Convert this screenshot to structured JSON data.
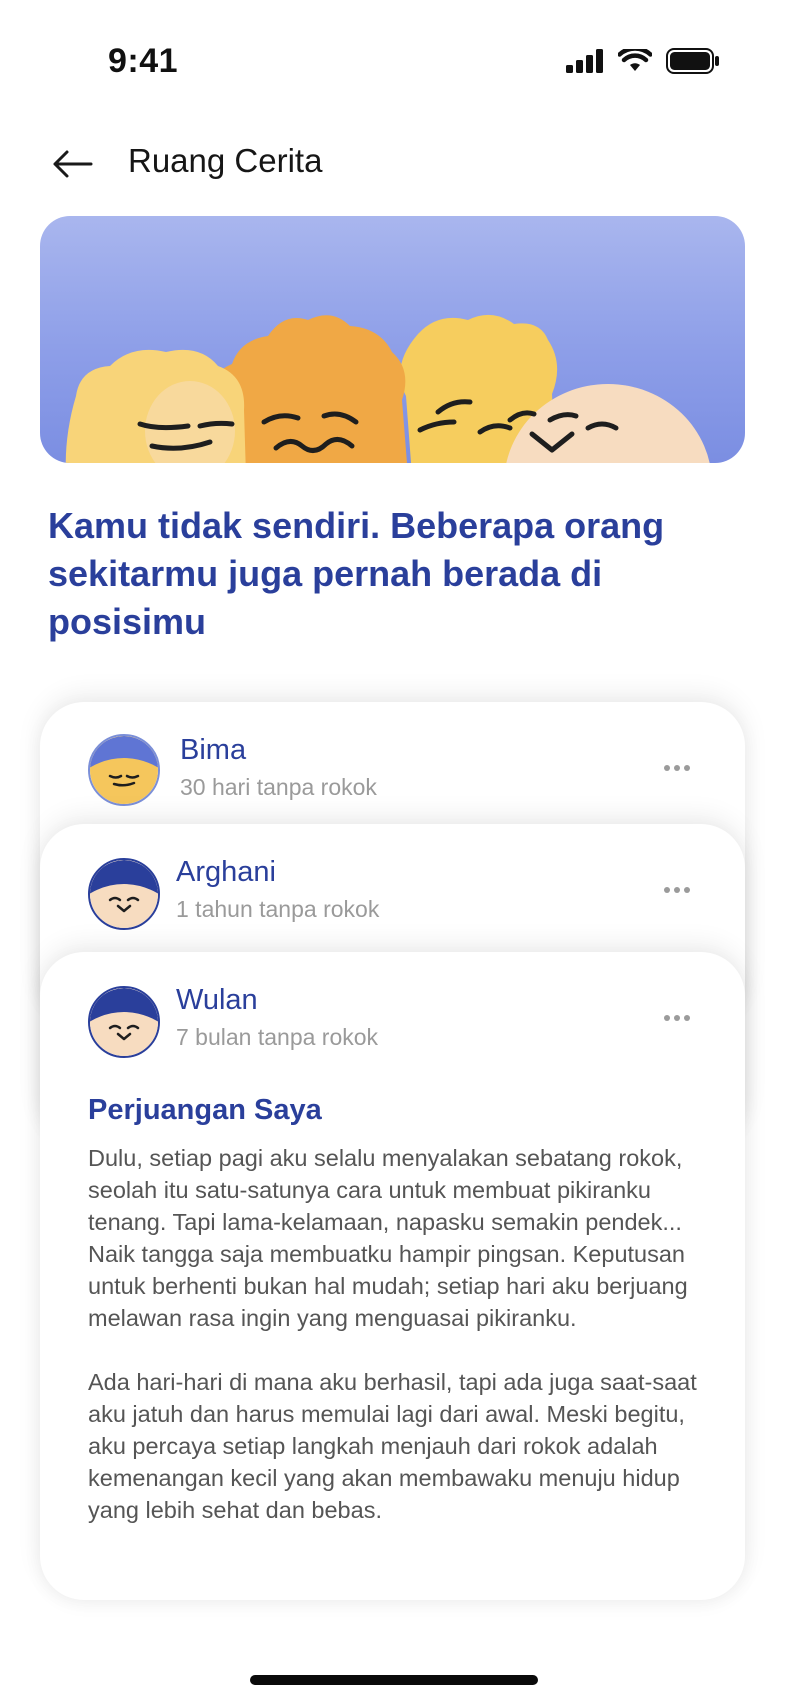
{
  "status_bar": {
    "time": "9:41"
  },
  "header": {
    "title": "Ruang Cerita"
  },
  "headline": "Kamu tidak sendiri. Beberapa orang sekitarmu juga pernah berada di posisimu",
  "stories": [
    {
      "name": "Bima",
      "subtitle": "30 hari tanpa rokok"
    },
    {
      "name": "Arghani",
      "subtitle": "1 tahun tanpa rokok"
    },
    {
      "name": "Wulan",
      "subtitle": "7 bulan tanpa rokok",
      "title": "Perjuangan Saya",
      "paragraphs": [
        "Dulu, setiap pagi aku selalu menyalakan sebatang rokok, seolah itu satu-satunya cara untuk membuat pikiranku tenang. Tapi lama-kelamaan, napasku semakin pendek... Naik tangga saja membuatku hampir pingsan. Keputusan untuk berhenti bukan hal mudah; setiap hari aku berjuang melawan rasa ingin yang menguasai pikiranku.",
        "Ada hari-hari di mana aku berhasil, tapi ada juga saat-saat aku jatuh dan harus memulai lagi dari awal. Meski begitu, aku percaya setiap langkah menjauh dari rokok adalah kemenangan kecil yang akan membawaku menuju hidup yang lebih sehat dan bebas."
      ]
    }
  ],
  "colors": {
    "accent": "#2a3f9b",
    "hero_blue": "#8d9ee8",
    "char_yellow": "#f6cd5e",
    "char_orange": "#f0a845",
    "char_cream": "#f7dcc0"
  },
  "icons": [
    "signal-icon",
    "wifi-icon",
    "battery-icon",
    "back-arrow-icon",
    "more-icon"
  ]
}
